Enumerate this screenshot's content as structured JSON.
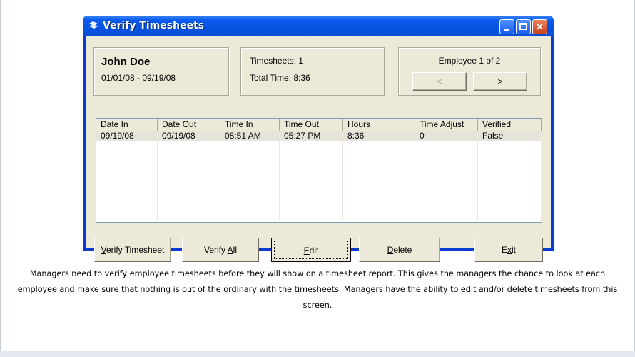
{
  "window": {
    "title": "Verify Timesheets",
    "title_icon": "app-logo-icon",
    "controls": {
      "minimize": "minimize-icon",
      "maximize": "maximize-icon",
      "close": "✕"
    }
  },
  "employee": {
    "name": "John Doe",
    "date_range": "01/01/08 - 09/19/08"
  },
  "summary": {
    "timesheets": "Timesheets: 1",
    "total_time": "Total Time: 8:36"
  },
  "navigation": {
    "counter": "Employee 1 of 2",
    "prev_label": "<",
    "next_label": ">"
  },
  "table": {
    "columns": [
      "Date In",
      "Date Out",
      "Time In",
      "Time Out",
      "Hours",
      "Time Adjust",
      "Verified"
    ],
    "rows": [
      [
        "09/19/08",
        "09/19/08",
        "08:51 AM",
        "05:27 PM",
        "8:36",
        "0",
        "False"
      ]
    ]
  },
  "buttons": {
    "verify_timesheet": {
      "pre": "",
      "u": "V",
      "post": "erify Timesheet"
    },
    "verify_all": {
      "pre": "Verify ",
      "u": "A",
      "post": "ll"
    },
    "edit": {
      "pre": "",
      "u": "E",
      "post": "dit"
    },
    "delete": {
      "pre": "",
      "u": "D",
      "post": "elete"
    },
    "exit": {
      "pre": "E",
      "u": "x",
      "post": "it"
    }
  },
  "description": "Managers need to verify employee timesheets before they will show on a timesheet report.  This gives the managers the chance to look at each employee and make sure that nothing is out of the ordinary with the timesheets.  Managers have the ability to edit and/or delete timesheets from this screen.",
  "colors": {
    "titlebar": "#0752e0",
    "window_face": "#ece9d8",
    "close_button": "#c9441f"
  }
}
